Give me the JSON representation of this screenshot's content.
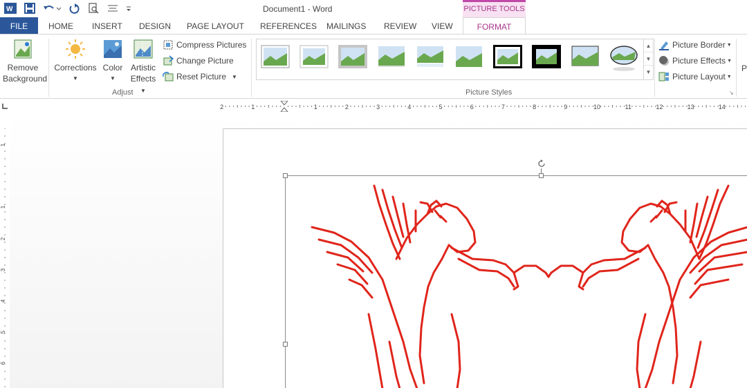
{
  "window": {
    "title": "Document1 - Word"
  },
  "context_tab": {
    "label": "PICTURE TOOLS"
  },
  "tabs": [
    "FILE",
    "HOME",
    "INSERT",
    "DESIGN",
    "PAGE LAYOUT",
    "REFERENCES",
    "MAILINGS",
    "REVIEW",
    "VIEW",
    "FORMAT"
  ],
  "ribbon": {
    "remove_background": {
      "line1": "Remove",
      "line2": "Background"
    },
    "corrections": "Corrections",
    "color": "Color",
    "artistic_effects": {
      "line1": "Artistic",
      "line2": "Effects"
    },
    "compress": "Compress Pictures",
    "change": "Change Picture",
    "reset": "Reset Picture",
    "adjust_label": "Adjust",
    "picture_styles_label": "Picture Styles",
    "picture_border": "Picture Border",
    "picture_effects": "Picture Effects",
    "picture_layout": "Picture Layout",
    "overflow": "P"
  },
  "ruler": {
    "h_labels": [
      "2",
      "1",
      "1",
      "2",
      "3",
      "4",
      "5",
      "6",
      "7",
      "8",
      "9",
      "10",
      "11",
      "12",
      "13",
      "14"
    ],
    "v_labels": [
      "1",
      "1",
      "2",
      "3",
      "4",
      "5",
      "6"
    ]
  },
  "colors": {
    "accent": "#2b579a",
    "picture_tools": "#a8368a",
    "art": "#e0251b"
  },
  "icons": [
    "word-logo-icon",
    "save-icon",
    "undo-icon",
    "redo-icon",
    "print-preview-icon",
    "touch-mode-icon",
    "customize-qat-icon",
    "rotate-handle-icon"
  ]
}
